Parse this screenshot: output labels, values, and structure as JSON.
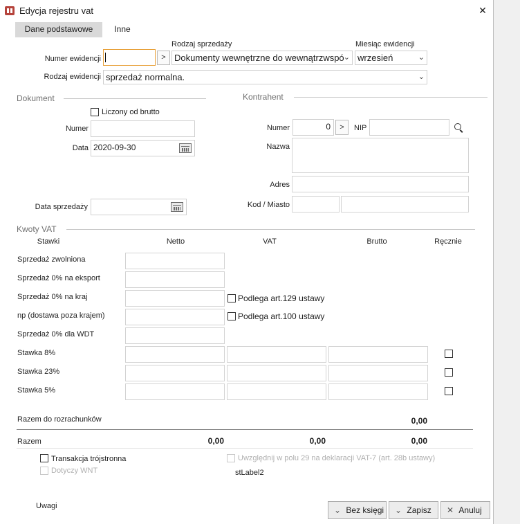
{
  "window": {
    "title": "Edycja rejestru vat",
    "close_glyph": "✕"
  },
  "tabs": [
    {
      "label": "Dane podstawowe"
    },
    {
      "label": "Inne"
    }
  ],
  "header": {
    "rodzaj_sprzedazy_label": "Rodzaj sprzedaży",
    "miesiac_ewidencji_label": "Miesiąc ewidencji",
    "numer_ewidencji_label": "Numer ewidencji",
    "numer_ewidencji_value": "",
    "arrow_glyph": ">",
    "rodzaj_sprzedazy_value": "Dokumenty wewnętrzne do wewnątrzwspó",
    "miesiac_value": "wrzesień",
    "rodzaj_ewidencji_label": "Rodzaj ewidencji",
    "rodzaj_ewidencji_value": "sprzedaż normalna."
  },
  "dokument": {
    "title": "Dokument",
    "liczony_od_brutto": "Liczony od brutto",
    "numer_label": "Numer",
    "numer_value": "",
    "data_label": "Data",
    "data_value": "2020-09-30",
    "data_sprzedazy_label": "Data sprzedaży",
    "data_sprzedazy_value": ""
  },
  "kontrahent": {
    "title": "Kontrahent",
    "numer_label": "Numer",
    "numer_value": "0",
    "nip_label": "NIP",
    "nip_value": "",
    "nazwa_label": "Nazwa",
    "adres_label": "Adres",
    "kod_miasto_label": "Kod / Miasto"
  },
  "kwoty": {
    "title": "Kwoty VAT",
    "headers": {
      "stawki": "Stawki",
      "netto": "Netto",
      "vat": "VAT",
      "brutto": "Brutto",
      "recznie": "Ręcznie"
    },
    "rows": [
      {
        "label": "Sprzedaż zwolniona"
      },
      {
        "label": "Sprzedaż 0% na eksport"
      },
      {
        "label": "Sprzedaż 0% na kraj"
      },
      {
        "label": "np (dostawa poza krajem)"
      },
      {
        "label": "Sprzedaż 0% dla WDT"
      },
      {
        "label": "Stawka 8%"
      },
      {
        "label": "Stawka 23%"
      },
      {
        "label": "Stawka 5%"
      }
    ],
    "podlega_129": "Podlega art.129 ustawy",
    "podlega_100": "Podlega art.100 ustawy",
    "razem_rozrachunkow_label": "Razem do rozrachunków",
    "razem_rozrachunkow_value": "0,00",
    "razem_label": "Razem",
    "razem_netto": "0,00",
    "razem_vat": "0,00",
    "razem_brutto": "0,00"
  },
  "options": {
    "transakcja": "Transakcja trójstronna",
    "dotyczy_wnt": "Dotyczy WNT",
    "uwzglednij": "Uwzględnij w polu 29 na deklaracji VAT-7 (art. 28b ustawy)",
    "stlabel": "stLabel2"
  },
  "footer": {
    "uwagi": "Uwagi",
    "bez_ksiegi": "Bez księgi",
    "zapisz": "Zapisz",
    "anuluj": "Anuluj"
  },
  "colors": {
    "accent": "#e8a13a",
    "tab_active": "#d9d9d9"
  }
}
